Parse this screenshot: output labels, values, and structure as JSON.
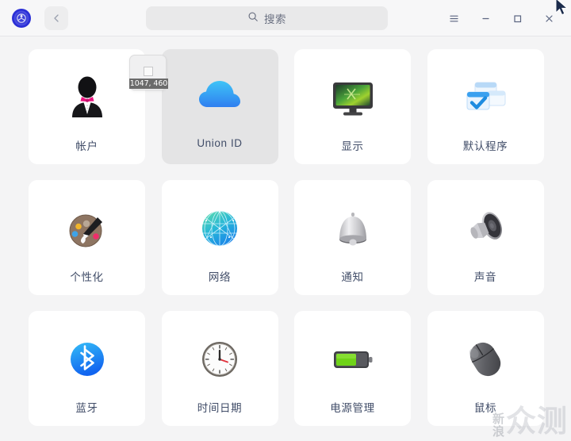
{
  "window": {
    "logo_icon": "deepin-logo-icon",
    "back_label": "‹",
    "menu_icon": "hamburger-menu-icon",
    "minimize_icon": "minimize-icon",
    "maximize_icon": "maximize-icon",
    "close_icon": "close-icon"
  },
  "search": {
    "placeholder": "搜索",
    "value": "",
    "icon": "search-icon"
  },
  "overlay": {
    "coordinates": "1047, 460",
    "cursor_icon": "cursor-arrow-icon"
  },
  "watermark": {
    "small": "新浪",
    "big": "众测"
  },
  "colors": {
    "background": "#f4f4f5",
    "tile": "#ffffff",
    "tile_hover": "#e4e4e5",
    "label": "#414d68",
    "accent_blue": "#1e90ff"
  },
  "grid": {
    "tiles": [
      {
        "label": "帐户",
        "icon": "accounts-icon",
        "hovered": false
      },
      {
        "label": "Union ID",
        "icon": "union-id-cloud-icon",
        "hovered": true
      },
      {
        "label": "显示",
        "icon": "display-monitor-icon",
        "hovered": false
      },
      {
        "label": "默认程序",
        "icon": "default-apps-icon",
        "hovered": false
      },
      {
        "label": "个性化",
        "icon": "personalization-palette-icon",
        "hovered": false
      },
      {
        "label": "网络",
        "icon": "network-globe-icon",
        "hovered": false
      },
      {
        "label": "通知",
        "icon": "notifications-bell-icon",
        "hovered": false
      },
      {
        "label": "声音",
        "icon": "sound-speaker-icon",
        "hovered": false
      },
      {
        "label": "蓝牙",
        "icon": "bluetooth-icon",
        "hovered": false
      },
      {
        "label": "时间日期",
        "icon": "datetime-clock-icon",
        "hovered": false
      },
      {
        "label": "电源管理",
        "icon": "power-battery-icon",
        "hovered": false
      },
      {
        "label": "鼠标",
        "icon": "mouse-icon",
        "hovered": false
      }
    ]
  }
}
